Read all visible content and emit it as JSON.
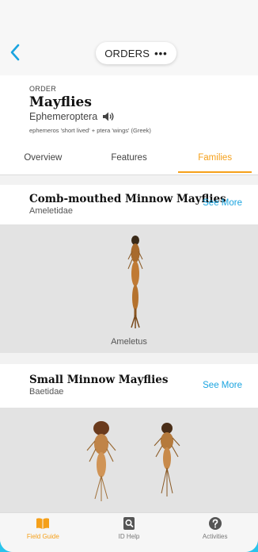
{
  "topbar": {
    "menu_label": "ORDERS",
    "menu_dots": "•••"
  },
  "header": {
    "kicker": "ORDER",
    "title": "Mayflies",
    "scientific_name": "Ephemeroptera",
    "etymology": "ephemeros 'short lived' + ptera 'wings' (Greek)"
  },
  "tabs": [
    {
      "label": "Overview",
      "active": false
    },
    {
      "label": "Features",
      "active": false
    },
    {
      "label": "Families",
      "active": true
    }
  ],
  "families": [
    {
      "name": "Comb-mouthed Minnow Mayflies",
      "latin": "Ameletidae",
      "see_more": "See More",
      "caption": "Ameletus"
    },
    {
      "name": "Small Minnow Mayflies",
      "latin": "Baetidae",
      "see_more": "See More",
      "caption": ""
    }
  ],
  "nav": [
    {
      "label": "Field Guide",
      "icon": "book-icon",
      "active": true
    },
    {
      "label": "ID Help",
      "icon": "magnifier-icon",
      "active": false
    },
    {
      "label": "Activities",
      "icon": "question-icon",
      "active": false
    }
  ],
  "colors": {
    "accent": "#f5a01a",
    "link": "#1aa4e0",
    "frame": "#29c4ec"
  }
}
